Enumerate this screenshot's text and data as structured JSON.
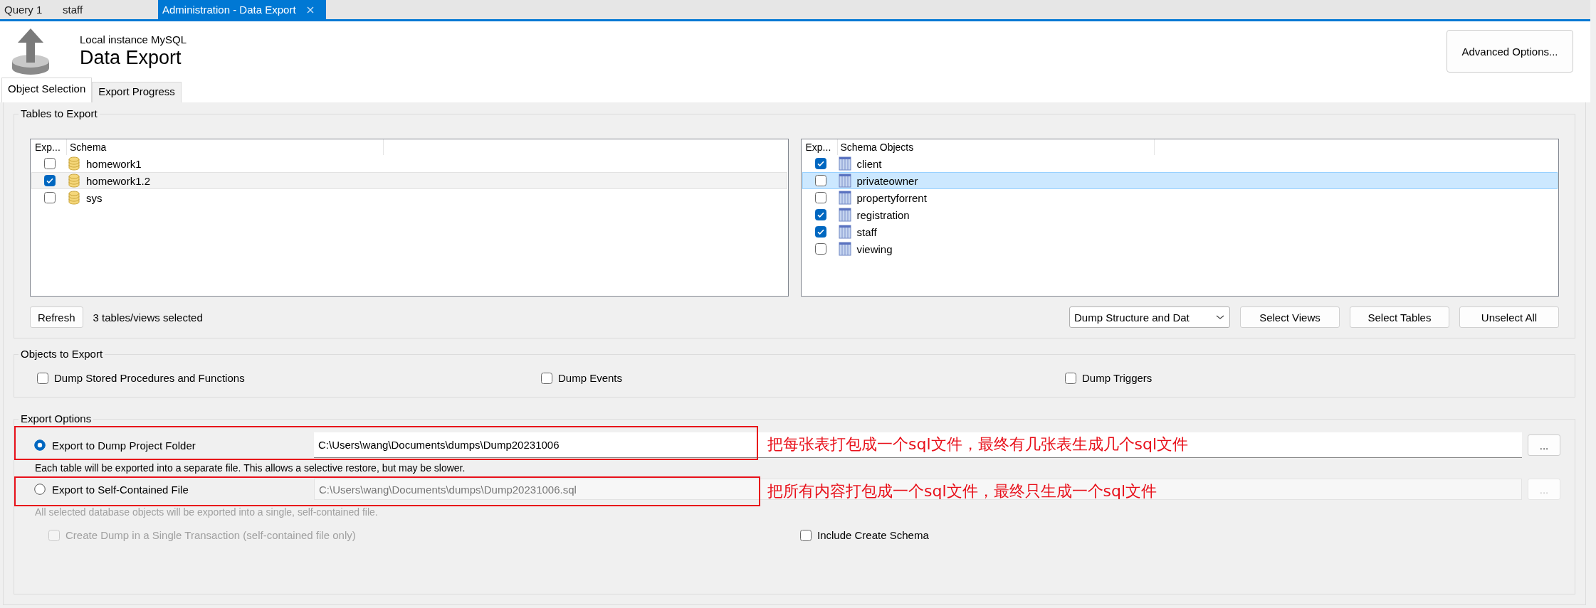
{
  "document_tabs": [
    {
      "label": "Query 1",
      "selected": false,
      "closable": false
    },
    {
      "label": "staff",
      "selected": false,
      "closable": false
    },
    {
      "label": "Administration - Data Export",
      "selected": true,
      "closable": true
    }
  ],
  "header": {
    "subtitle": "Local instance MySQL",
    "title": "Data Export",
    "advanced_button": "Advanced Options..."
  },
  "page_tabs": [
    {
      "label": "Object Selection",
      "selected": true
    },
    {
      "label": "Export Progress",
      "selected": false
    }
  ],
  "tables_to_export": {
    "title": "Tables to Export",
    "schemas": {
      "focused": false,
      "columns": [
        "Exp...",
        "Schema"
      ],
      "rows": [
        {
          "name": "homework1",
          "checked": false,
          "selected": false
        },
        {
          "name": "homework1.2",
          "checked": true,
          "selected": true
        },
        {
          "name": "sys",
          "checked": false,
          "selected": false
        }
      ]
    },
    "objects": {
      "focused": true,
      "columns": [
        "Exp...",
        "Schema Objects"
      ],
      "rows": [
        {
          "name": "client",
          "checked": true,
          "selected": false
        },
        {
          "name": "privateowner",
          "checked": false,
          "selected": true
        },
        {
          "name": "propertyforrent",
          "checked": false,
          "selected": false
        },
        {
          "name": "registration",
          "checked": true,
          "selected": false
        },
        {
          "name": "staff",
          "checked": true,
          "selected": false
        },
        {
          "name": "viewing",
          "checked": false,
          "selected": false
        }
      ]
    },
    "refresh_button": "Refresh",
    "selection_count": "3 tables/views selected",
    "dump_mode": "Dump Structure and Dat",
    "buttons": [
      "Select Views",
      "Select Tables",
      "Unselect All"
    ]
  },
  "objects_to_export": {
    "title": "Objects to Export",
    "options": [
      {
        "label": "Dump Stored Procedures and Functions",
        "checked": false
      },
      {
        "label": "Dump Events",
        "checked": false
      },
      {
        "label": "Dump Triggers",
        "checked": false
      }
    ]
  },
  "export_options": {
    "title": "Export Options",
    "modes": [
      {
        "label": "Export to Dump Project Folder",
        "selected": true,
        "path": "C:\\Users\\wang\\Documents\\dumps\\Dump20231006",
        "browse_button": "...",
        "description": "Each table will be exported into a separate file. This allows a selective restore, but may be slower."
      },
      {
        "label": "Export to Self-Contained File",
        "selected": false,
        "path": "C:\\Users\\wang\\Documents\\dumps\\Dump20231006.sql",
        "browse_button": "...",
        "description": "All selected database objects will be exported into a single, self-contained file."
      }
    ],
    "single_transaction": {
      "label": "Create Dump in a Single Transaction (self-contained file only)",
      "checked": false,
      "disabled": true
    },
    "include_create_schema": {
      "label": "Include Create Schema",
      "checked": false,
      "disabled": false
    }
  },
  "annotations": [
    {
      "text": "把每张表打包成一个sql文件，最终有几张表生成几个sql文件"
    },
    {
      "text": "把所有内容打包成一个sql文件，最终只生成一个sql文件"
    }
  ]
}
